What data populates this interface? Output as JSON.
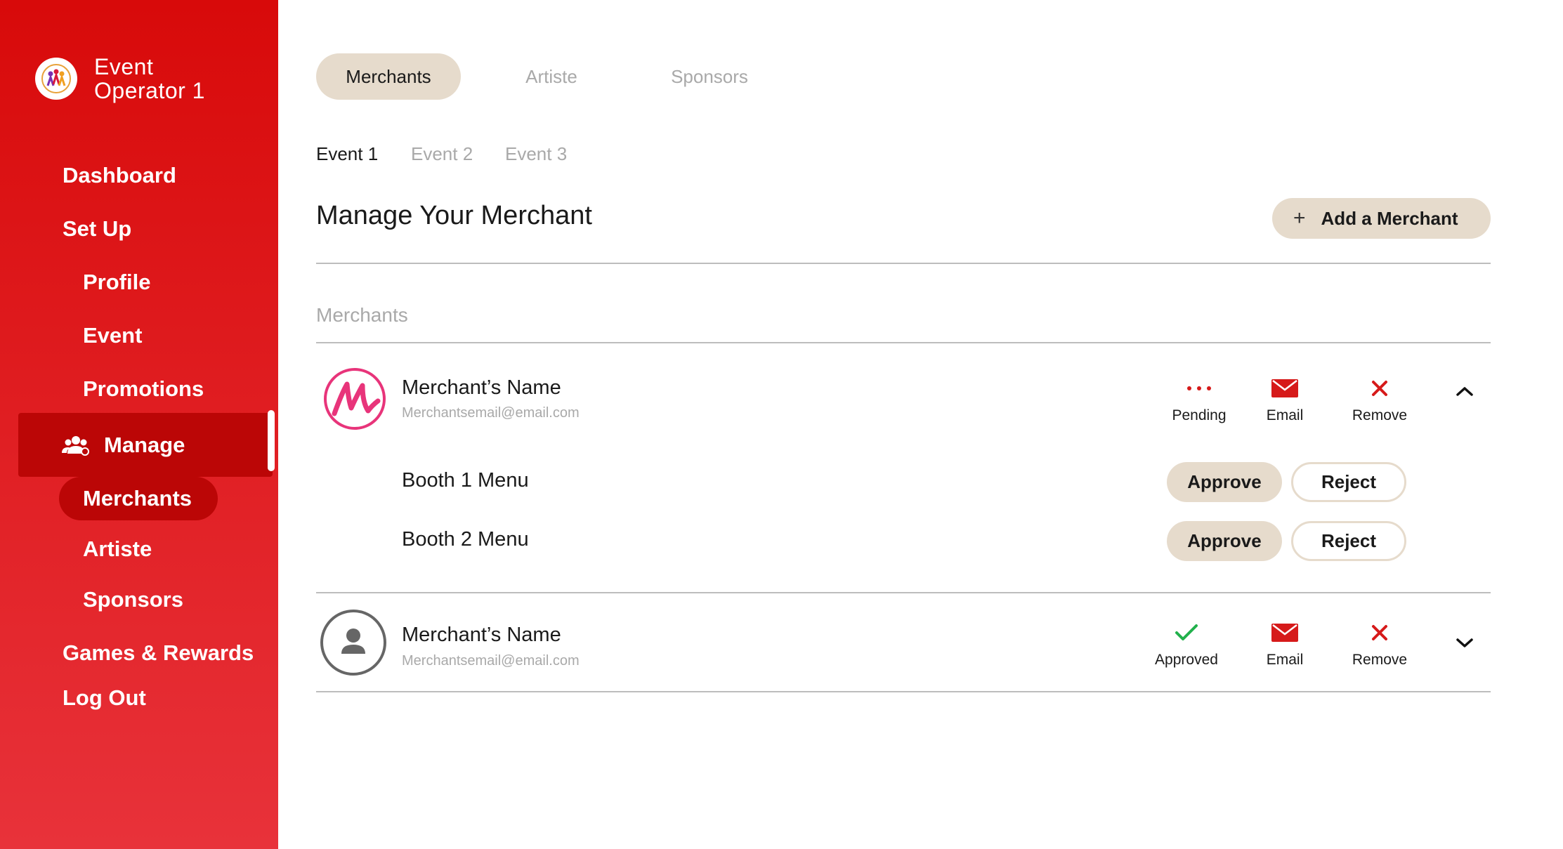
{
  "sidebar": {
    "brand": {
      "line1": "Event",
      "line2": "Operator 1",
      "logo_icon": "people-logo-icon"
    },
    "items": {
      "dashboard": "Dashboard",
      "setup": "Set Up",
      "profile": "Profile",
      "event": "Event",
      "promotions": "Promotions",
      "manage": "Manage",
      "merchants": "Merchants",
      "artiste": "Artiste",
      "sponsors": "Sponsors",
      "games": "Games & Rewards",
      "logout": "Log Out"
    },
    "active_item": "Manage",
    "active_subitem": "Merchants"
  },
  "tabs": [
    "Merchants",
    "Artiste",
    "Sponsors"
  ],
  "event_tabs": [
    "Event 1",
    "Event 2",
    "Event 3"
  ],
  "main": {
    "title": "Manage Your Merchant",
    "add_button": "Add a Merchant",
    "section_label": "Merchants"
  },
  "merchants": [
    {
      "name": "Merchant’s Name",
      "email": "Merchantsemail@email.com",
      "status": "Pending",
      "email_label": "Email",
      "remove_label": "Remove",
      "expanded": true,
      "booths": [
        {
          "label": "Booth 1 Menu",
          "approve": "Approve",
          "reject": "Reject"
        },
        {
          "label": "Booth 2 Menu",
          "approve": "Approve",
          "reject": "Reject"
        }
      ]
    },
    {
      "name": "Merchant’s Name",
      "email": "Merchantsemail@email.com",
      "status": "Approved",
      "email_label": "Email",
      "remove_label": "Remove",
      "expanded": false
    }
  ],
  "colors": {
    "sidebar_top": "#d80a0a",
    "sidebar_bottom": "#e8323a",
    "active_bg": "#bb0606",
    "pill": "#e6dbcc",
    "pending": "#d61a1a",
    "approved": "#22b14c",
    "remove": "#d61a1a",
    "email": "#d61a1a"
  }
}
